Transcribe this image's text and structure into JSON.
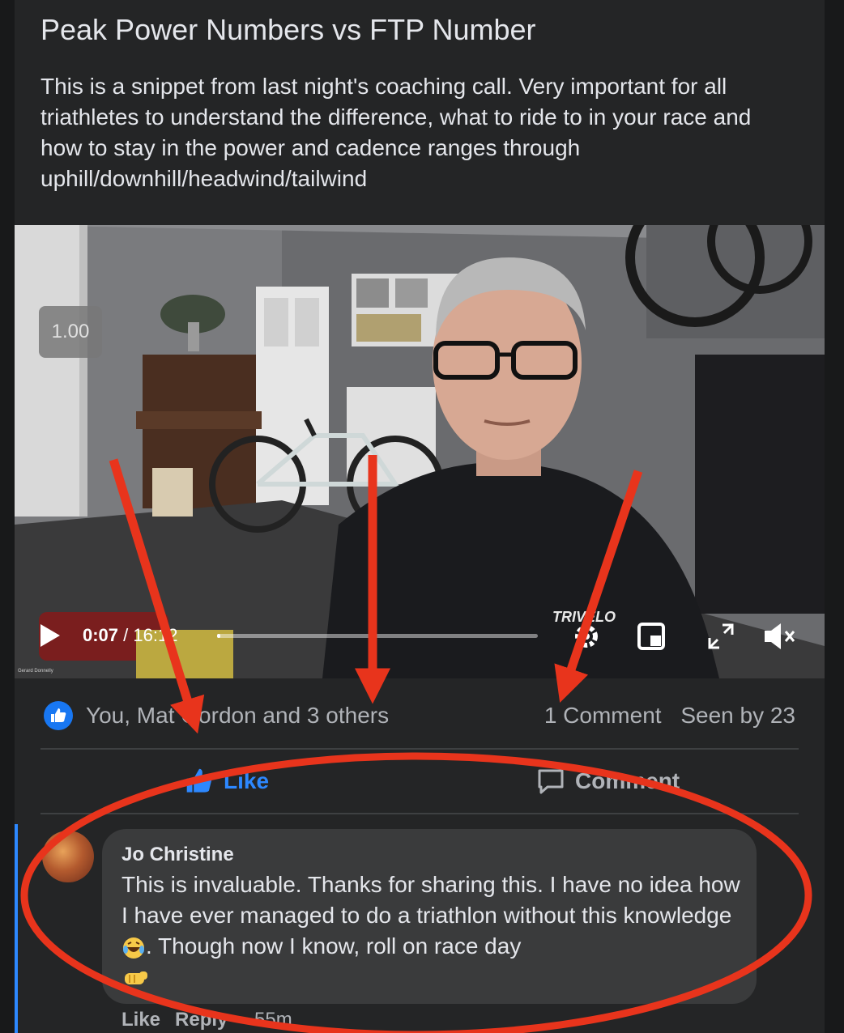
{
  "post": {
    "title": "Peak Power Numbers vs FTP Number",
    "description": "This is a snippet from last night's coaching call. Very important for all triathletes to understand the difference, what to ride to in your race and how to stay in the power and cadence ranges through uphill/downhill/headwind/tailwind"
  },
  "video": {
    "speed_label": "1.00",
    "current_time": "0:07",
    "duration": "/ 16:12",
    "progress_fraction": 0.007,
    "credit": "Gerard Donnelly",
    "shirt_logo": "TRIVELO"
  },
  "reactions": {
    "summary": "You, Mat Gordon and 3 others",
    "comment_count": "1 Comment",
    "seen_by": "Seen by 23"
  },
  "actions": {
    "like_label": "Like",
    "comment_label": "Comment"
  },
  "comment": {
    "author": "Jo Christine",
    "text_part1": "This is invaluable. Thanks for sharing this. I have no idea how I have ever managed to do a triathlon without this knowledge ",
    "text_part2": ". Though now I know, roll on race day",
    "like_label": "Like",
    "reply_label": "Reply",
    "time": "· 55m"
  },
  "colors": {
    "accent": "#2d88ff",
    "annotation": "#e8341c",
    "background": "#242526"
  }
}
